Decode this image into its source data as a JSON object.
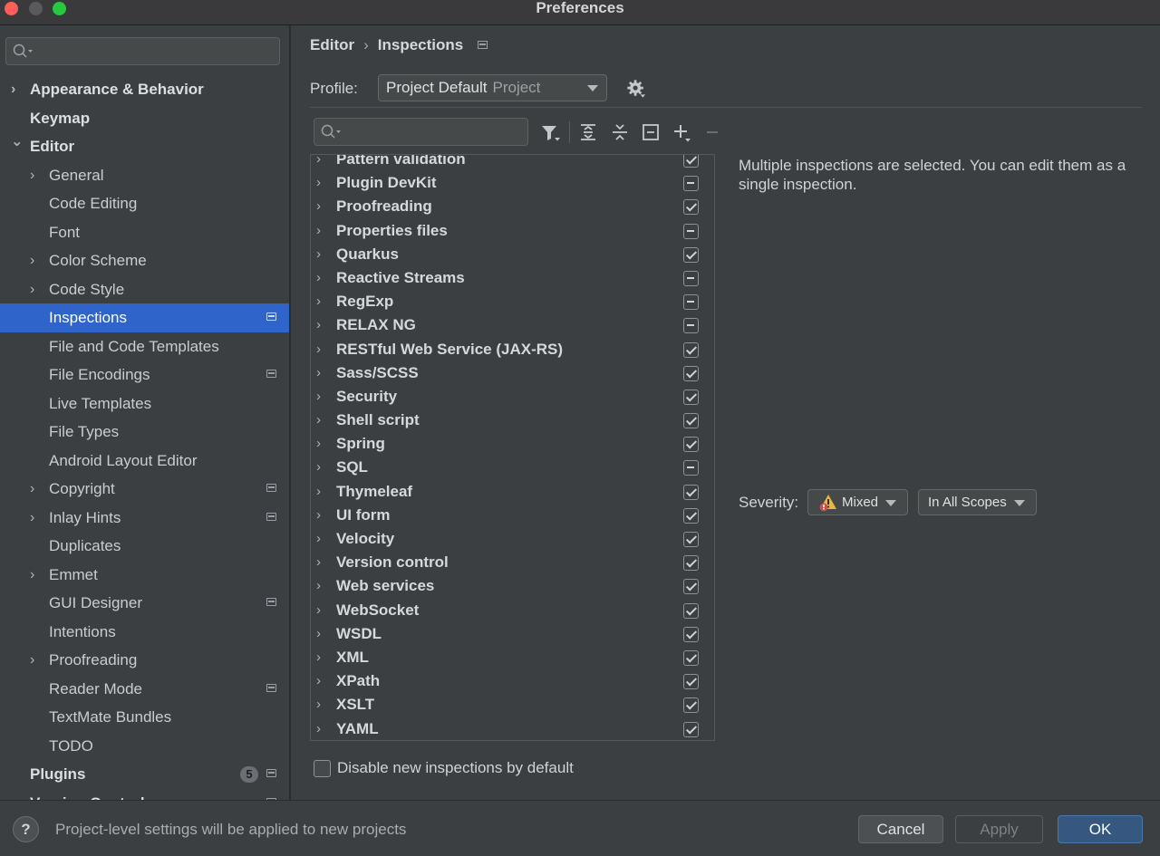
{
  "window": {
    "title": "Preferences"
  },
  "sidebar": {
    "search_placeholder": "",
    "items": [
      {
        "label": "Appearance & Behavior",
        "level": 0,
        "expandable": true,
        "expanded": false
      },
      {
        "label": "Keymap",
        "level": 0,
        "expandable": false
      },
      {
        "label": "Editor",
        "level": 0,
        "expandable": true,
        "expanded": true
      },
      {
        "label": "General",
        "level": 1,
        "expandable": true
      },
      {
        "label": "Code Editing",
        "level": 1
      },
      {
        "label": "Font",
        "level": 1
      },
      {
        "label": "Color Scheme",
        "level": 1,
        "expandable": true
      },
      {
        "label": "Code Style",
        "level": 1,
        "expandable": true
      },
      {
        "label": "Inspections",
        "level": 1,
        "selected": true,
        "project_icon": true
      },
      {
        "label": "File and Code Templates",
        "level": 1
      },
      {
        "label": "File Encodings",
        "level": 1,
        "project_icon": true
      },
      {
        "label": "Live Templates",
        "level": 1
      },
      {
        "label": "File Types",
        "level": 1
      },
      {
        "label": "Android Layout Editor",
        "level": 1
      },
      {
        "label": "Copyright",
        "level": 1,
        "expandable": true,
        "project_icon": true
      },
      {
        "label": "Inlay Hints",
        "level": 1,
        "expandable": true,
        "project_icon": true
      },
      {
        "label": "Duplicates",
        "level": 1
      },
      {
        "label": "Emmet",
        "level": 1,
        "expandable": true
      },
      {
        "label": "GUI Designer",
        "level": 1,
        "project_icon": true
      },
      {
        "label": "Intentions",
        "level": 1
      },
      {
        "label": "Proofreading",
        "level": 1,
        "expandable": true
      },
      {
        "label": "Reader Mode",
        "level": 1,
        "project_icon": true
      },
      {
        "label": "TextMate Bundles",
        "level": 1
      },
      {
        "label": "TODO",
        "level": 1
      },
      {
        "label": "Plugins",
        "level": 0,
        "badge": "5",
        "project_icon": true
      },
      {
        "label": "Version Control",
        "level": 0,
        "expandable": true,
        "project_icon": true
      }
    ]
  },
  "breadcrumb": {
    "parent": "Editor",
    "current": "Inspections"
  },
  "profile": {
    "label": "Profile:",
    "name": "Project Default",
    "scope": "Project"
  },
  "inspections": [
    {
      "label": "Pattern validation",
      "state": "checked"
    },
    {
      "label": "Plugin DevKit",
      "state": "mixed"
    },
    {
      "label": "Proofreading",
      "state": "checked"
    },
    {
      "label": "Properties files",
      "state": "mixed"
    },
    {
      "label": "Quarkus",
      "state": "checked"
    },
    {
      "label": "Reactive Streams",
      "state": "mixed"
    },
    {
      "label": "RegExp",
      "state": "mixed"
    },
    {
      "label": "RELAX NG",
      "state": "mixed"
    },
    {
      "label": "RESTful Web Service (JAX-RS)",
      "state": "checked"
    },
    {
      "label": "Sass/SCSS",
      "state": "checked"
    },
    {
      "label": "Security",
      "state": "checked"
    },
    {
      "label": "Shell script",
      "state": "checked"
    },
    {
      "label": "Spring",
      "state": "checked"
    },
    {
      "label": "SQL",
      "state": "mixed"
    },
    {
      "label": "Thymeleaf",
      "state": "checked"
    },
    {
      "label": "UI form",
      "state": "checked"
    },
    {
      "label": "Velocity",
      "state": "checked"
    },
    {
      "label": "Version control",
      "state": "checked"
    },
    {
      "label": "Web services",
      "state": "checked"
    },
    {
      "label": "WebSocket",
      "state": "checked"
    },
    {
      "label": "WSDL",
      "state": "checked"
    },
    {
      "label": "XML",
      "state": "checked"
    },
    {
      "label": "XPath",
      "state": "checked"
    },
    {
      "label": "XSLT",
      "state": "checked"
    },
    {
      "label": "YAML",
      "state": "checked"
    }
  ],
  "description": "Multiple inspections are selected. You can edit them as a single inspection.",
  "severity": {
    "label": "Severity:",
    "value": "Mixed",
    "scope": "In All Scopes"
  },
  "disable_new": {
    "label": "Disable new inspections by default",
    "checked": false
  },
  "footer": {
    "help": "?",
    "message": "Project-level settings will be applied to new projects",
    "cancel": "Cancel",
    "apply": "Apply",
    "ok": "OK"
  },
  "colors": {
    "selection": "#2f65ca",
    "ok_button": "#365880",
    "background": "#3c3f41"
  }
}
